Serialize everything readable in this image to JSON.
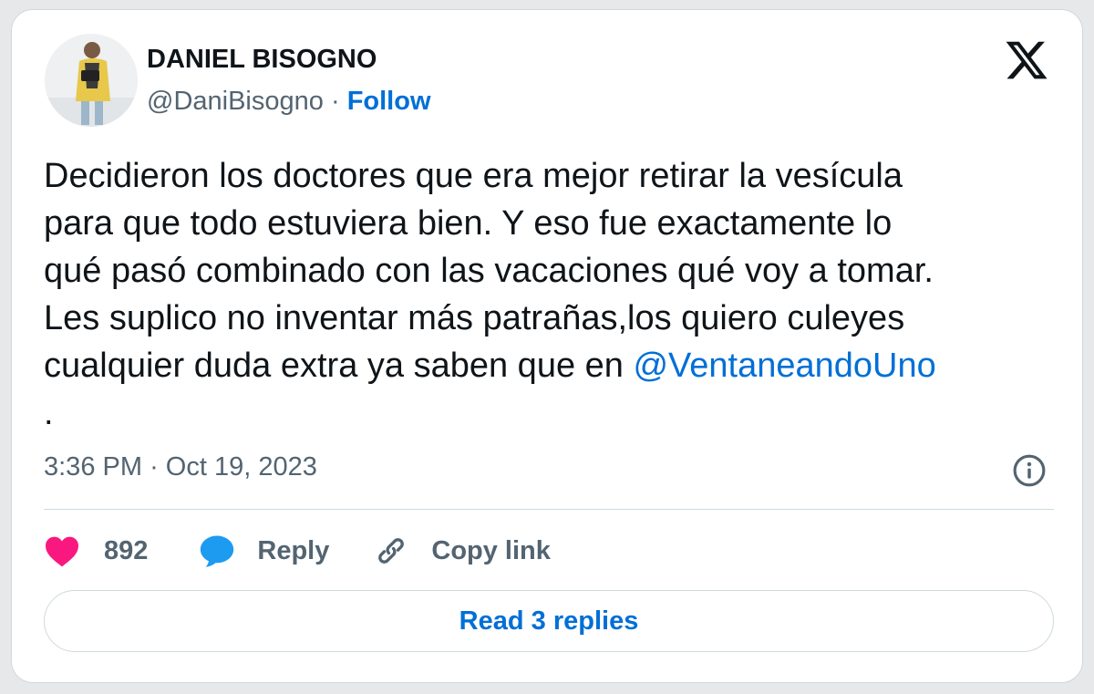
{
  "author": {
    "display_name": "DANIEL BISOGNO",
    "handle": "@DaniBisogno",
    "separator": "·",
    "follow_label": "Follow"
  },
  "tweet": {
    "lines": [
      "Decidieron los doctores que era mejor retirar la vesícula",
      "para que todo estuviera bien. Y eso fue exactamente lo",
      "qué pasó combinado con las vacaciones qué voy a tomar.",
      "Les suplico no inventar más patrañas,los quiero culeyes",
      "cualquier duda extra ya saben que en "
    ],
    "mention": "@VentaneandoUno",
    "trailing": "."
  },
  "timestamp": {
    "time": "3:36 PM",
    "separator": "·",
    "date": "Oct 19, 2023"
  },
  "actions": {
    "like_count": "892",
    "reply_label": "Reply",
    "copy_link_label": "Copy link"
  },
  "read_replies_label": "Read 3 replies",
  "colors": {
    "link_blue": "#006fd6",
    "like_pink": "#f91880",
    "reply_blue": "#1d9bf0",
    "text_dark": "#0f1419",
    "text_muted": "#536471",
    "border": "#cfd9de"
  },
  "icons": {
    "brand": "x-logo-icon",
    "info": "info-icon",
    "like": "heart-icon",
    "reply": "speech-bubble-icon",
    "copy": "link-icon"
  }
}
